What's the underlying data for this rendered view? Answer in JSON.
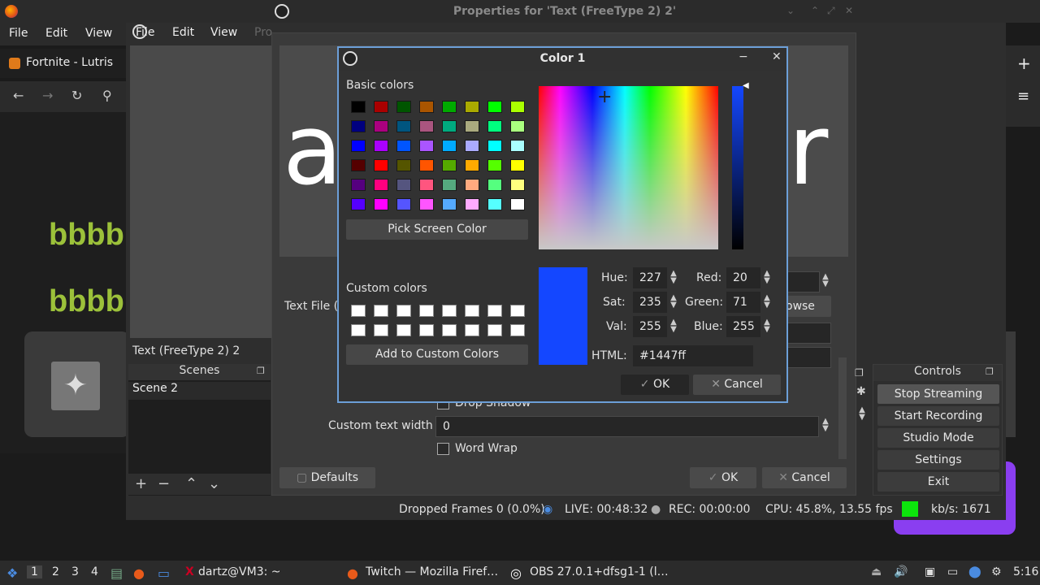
{
  "desktop": {
    "title": "Properties for 'Text (FreeType 2) 2'"
  },
  "firefox": {
    "menu": [
      "File",
      "Edit",
      "View"
    ],
    "tab_title": "Fortnite - Lutris",
    "text_lines": [
      "bbbb",
      "bbbb"
    ]
  },
  "obs": {
    "menu": [
      "File",
      "Edit",
      "View",
      "Pro"
    ],
    "source_name": "Text (FreeType 2) 2",
    "scenes": {
      "header": "Scenes",
      "items": [
        "Scene 2"
      ]
    },
    "controls": {
      "header": "Controls",
      "buttons": [
        "Stop Streaming",
        "Start Recording",
        "Studio Mode",
        "Settings",
        "Exit"
      ]
    },
    "status": {
      "dropped": "Dropped Frames 0 (0.0%)",
      "live": "LIVE: 00:48:32",
      "rec": "REC: 00:00:00",
      "cpu": "CPU: 45.8%, 13.55 fps",
      "kbps": "kb/s: 1671"
    }
  },
  "properties": {
    "preview_left": "a",
    "preview_right": "r",
    "text_file_label": "Text File (",
    "browse_label": "owse",
    "drop_shadow_label": "Drop Shadow",
    "custom_width_label": "Custom text width",
    "custom_width_value": "0",
    "word_wrap_label": "Word Wrap",
    "defaults_label": "Defaults",
    "ok_label": "OK",
    "cancel_label": "Cancel"
  },
  "color_dialog": {
    "title": "Color 1",
    "basic_colors_label": "Basic colors",
    "pick_screen_label": "Pick Screen Color",
    "custom_colors_label": "Custom colors",
    "add_custom_label": "Add to Custom Colors",
    "hue_label": "Hue:",
    "hue": "227",
    "sat_label": "Sat:",
    "sat": "235",
    "val_label": "Val:",
    "val": "255",
    "red_label": "Red:",
    "red": "20",
    "green_label": "Green:",
    "green": "71",
    "blue_label": "Blue:",
    "blue": "255",
    "html_label": "HTML:",
    "html": "#1447ff",
    "ok_label": "OK",
    "cancel_label": "Cancel",
    "selected_color": "#1447ff",
    "basic_colors": [
      "#000000",
      "#aa0000",
      "#005500",
      "#aa5500",
      "#00aa00",
      "#aaaa00",
      "#00ff00",
      "#aaff00",
      "#00007f",
      "#aa007f",
      "#00557f",
      "#aa557f",
      "#00aa7f",
      "#aaaa7f",
      "#00ff7f",
      "#aaff7f",
      "#0000ff",
      "#aa00ff",
      "#0055ff",
      "#aa55ff",
      "#00aaff",
      "#aaaaff",
      "#00ffff",
      "#aaffff",
      "#550000",
      "#ff0000",
      "#555500",
      "#ff5500",
      "#55aa00",
      "#ffaa00",
      "#55ff00",
      "#ffff00",
      "#55007f",
      "#ff007f",
      "#55557f",
      "#ff557f",
      "#55aa7f",
      "#ffaa7f",
      "#55ff7f",
      "#ffff7f",
      "#5500ff",
      "#ff00ff",
      "#5555ff",
      "#ff55ff",
      "#55aaff",
      "#ffaaff",
      "#55ffff",
      "#ffffff"
    ]
  },
  "taskbar": {
    "workspaces": [
      "1",
      "2",
      "3",
      "4"
    ],
    "terminal": "dartz@VM3: ~",
    "firefox": "Twitch — Mozilla Firef…",
    "obs": "OBS 27.0.1+dfsg1-1 (l…",
    "clock": "5:16"
  }
}
